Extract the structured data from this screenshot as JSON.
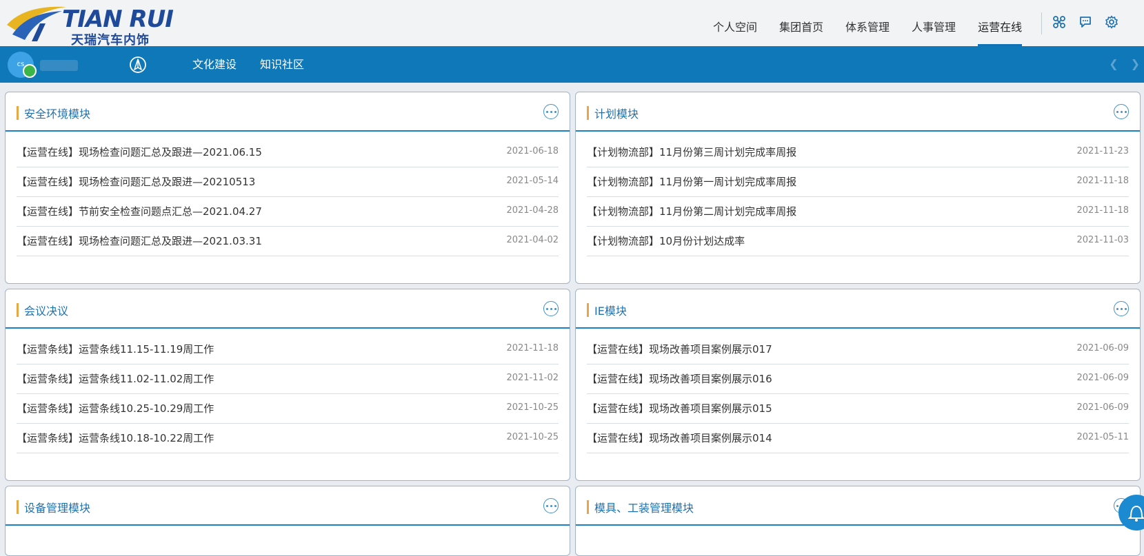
{
  "brand": {
    "name_en": "TIAN RUI",
    "name_cn": "天瑞汽车内饰"
  },
  "top_nav": [
    {
      "label": "个人空间",
      "active": false
    },
    {
      "label": "集团首页",
      "active": false
    },
    {
      "label": "体系管理",
      "active": false
    },
    {
      "label": "人事管理",
      "active": false
    },
    {
      "label": "运营在线",
      "active": true
    }
  ],
  "top_icons": [
    "apps-icon",
    "chat-icon",
    "settings-icon"
  ],
  "user": {
    "avatar_text": "cs"
  },
  "sub_nav": [
    "文化建设",
    "知识社区"
  ],
  "colors": {
    "primary": "#0f78b9",
    "accent": "#e7a745",
    "title": "#1f72b0"
  },
  "panels": [
    {
      "title": "安全环境模块",
      "items": [
        {
          "text": "【运营在线】现场检查问题汇总及跟进—2021.06.15",
          "date": "2021-06-18"
        },
        {
          "text": "【运营在线】现场检查问题汇总及跟进—20210513",
          "date": "2021-05-14"
        },
        {
          "text": "【运营在线】节前安全检查问题点汇总—2021.04.27",
          "date": "2021-04-28"
        },
        {
          "text": "【运营在线】现场检查问题汇总及跟进—2021.03.31",
          "date": "2021-04-02"
        }
      ]
    },
    {
      "title": "计划模块",
      "items": [
        {
          "text": "【计划物流部】11月份第三周计划完成率周报",
          "date": "2021-11-23"
        },
        {
          "text": "【计划物流部】11月份第一周计划完成率周报",
          "date": "2021-11-18"
        },
        {
          "text": "【计划物流部】11月份第二周计划完成率周报",
          "date": "2021-11-18"
        },
        {
          "text": "【计划物流部】10月份计划达成率",
          "date": "2021-11-03"
        }
      ]
    },
    {
      "title": "会议决议",
      "items": [
        {
          "text": "【运营条线】运营条线11.15-11.19周工作",
          "date": "2021-11-18"
        },
        {
          "text": "【运营条线】运营条线11.02-11.02周工作",
          "date": "2021-11-02"
        },
        {
          "text": "【运营条线】运营条线10.25-10.29周工作",
          "date": "2021-10-25"
        },
        {
          "text": "【运营条线】运营条线10.18-10.22周工作",
          "date": "2021-10-25"
        }
      ]
    },
    {
      "title": "IE模块",
      "items": [
        {
          "text": "【运营在线】现场改善项目案例展示017",
          "date": "2021-06-09"
        },
        {
          "text": "【运营在线】现场改善项目案例展示016",
          "date": "2021-06-09"
        },
        {
          "text": "【运营在线】现场改善项目案例展示015",
          "date": "2021-06-09"
        },
        {
          "text": "【运营在线】现场改善项目案例展示014",
          "date": "2021-05-11"
        }
      ]
    },
    {
      "title": "设备管理模块",
      "items": []
    },
    {
      "title": "模具、工装管理模块",
      "items": []
    }
  ]
}
